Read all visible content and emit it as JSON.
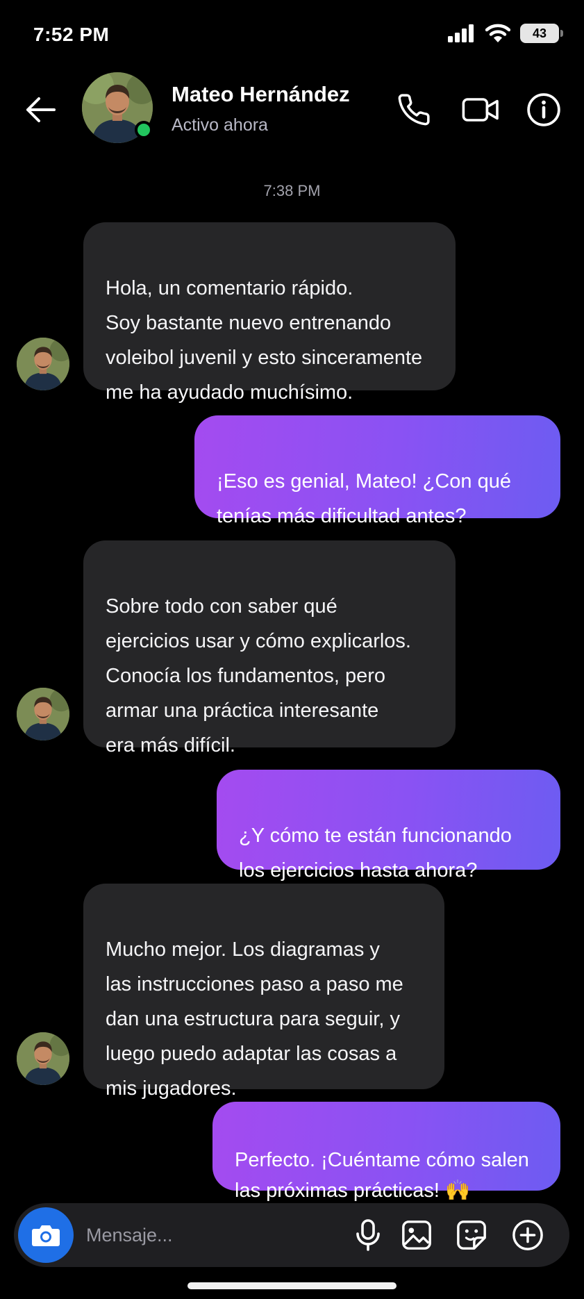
{
  "status_bar": {
    "time": "7:52 PM",
    "battery": "43"
  },
  "header": {
    "contact_name": "Mateo Hernández",
    "contact_status": "Activo ahora",
    "online_color": "#22c55e",
    "icons": [
      "back-arrow-icon",
      "phone-icon",
      "video-camera-icon",
      "info-icon"
    ]
  },
  "conversation": {
    "timestamp": "7:38 PM",
    "messages": [
      {
        "direction": "incoming",
        "text": "Hola, un comentario rápido.\nSoy bastante nuevo entrenando\nvoleibol juvenil y esto sinceramente\nme ha ayudado muchísimo."
      },
      {
        "direction": "outgoing",
        "text": "¡Eso es genial, Mateo! ¿Con qué\ntenías más dificultad antes?"
      },
      {
        "direction": "incoming",
        "text": "Sobre todo con saber qué\nejercicios usar y cómo explicarlos.\nConocía los fundamentos, pero\narmar una práctica interesante\nera más difícil."
      },
      {
        "direction": "outgoing",
        "text": "¿Y cómo te están funcionando\nlos ejercicios hasta ahora?"
      },
      {
        "direction": "incoming",
        "text": "Mucho mejor. Los diagramas y\nlas instrucciones paso a paso me\ndan una estructura para seguir, y\nluego puedo adaptar las cosas a\nmis jugadores."
      },
      {
        "direction": "outgoing",
        "text": "Perfecto. ¡Cuéntame cómo salen\nlas próximas prácticas! 🙌"
      }
    ]
  },
  "composer": {
    "placeholder": "Mensaje...",
    "icons": [
      "camera-icon",
      "microphone-icon",
      "image-icon",
      "sticker-icon",
      "add-icon"
    ],
    "camera_color": "#1f6fe6"
  },
  "colors": {
    "background": "#000000",
    "incoming_bubble": "#262628",
    "outgoing_gradient": [
      "#a44bf0",
      "#6d5cf2"
    ]
  }
}
